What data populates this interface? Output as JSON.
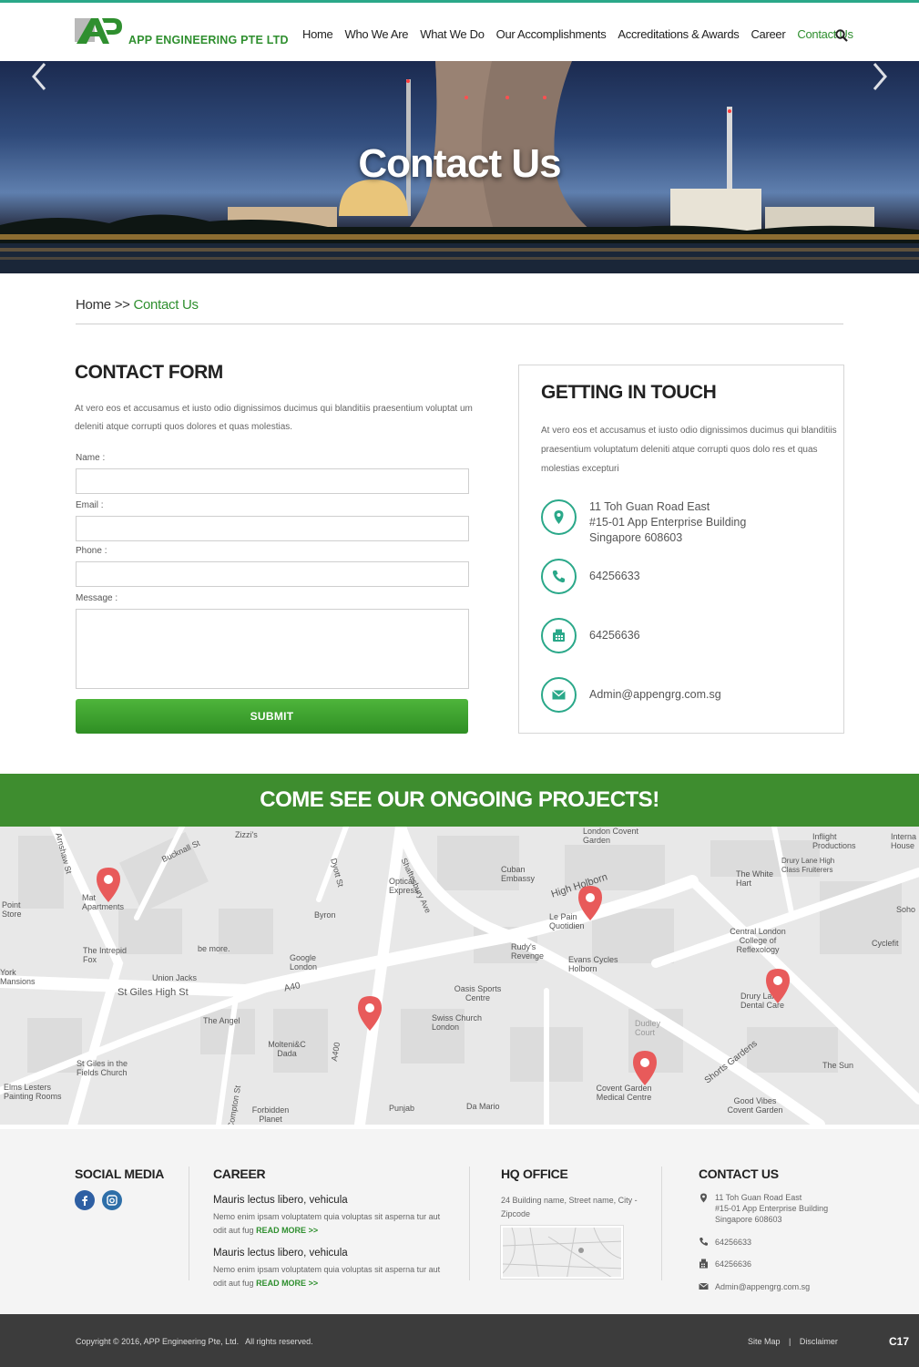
{
  "header": {
    "company": "APP ENGINEERING PTE LTD",
    "nav": [
      "Home",
      "Who We Are",
      "What We Do",
      "Our Accomplishments",
      "Accreditations & Awards",
      "Career",
      "Contact Us"
    ],
    "active_nav": "Contact Us"
  },
  "hero": {
    "title": "Contact Us"
  },
  "breadcrumb": {
    "home": "Home",
    "sep": ">>",
    "current": "Contact Us"
  },
  "contact_form": {
    "title": "CONTACT FORM",
    "description": "At vero eos et accusamus et iusto odio dignissimos ducimus qui blanditiis praesentium voluptat um deleniti atque corrupti quos dolores et quas molestias.",
    "name_label": "Name :",
    "email_label": "Email :",
    "phone_label": "Phone :",
    "message_label": "Message :",
    "name_value": "",
    "email_value": "",
    "phone_value": "",
    "message_value": "",
    "submit_label": "SUBMIT"
  },
  "getting_in_touch": {
    "title": "GETTING IN TOUCH",
    "description": "At vero eos et accusamus et iusto odio dignissimos ducimus qui blanditiis praesentium voluptatum deleniti atque corrupti quos dolo res et quas molestias excepturi",
    "address_line1": "11 Toh Guan Road East",
    "address_line2": "#15-01 App Enterprise Building",
    "address_line3": "Singapore 608603",
    "phone": "64256633",
    "fax": "64256636",
    "email": "Admin@appengrg.com.sg"
  },
  "projects": {
    "title": "COME SEE OUR ONGOING PROJECTS!",
    "map_labels": [
      "Zizzi's",
      "Bucknall St",
      "Optical Express",
      "Shaftesbury Ave",
      "London Covent Garden",
      "Inflight Productions",
      "Interna House",
      "Cuban Embassy",
      "High Holborn",
      "Drury Lane High Class Fruiterers",
      "The White Hart",
      "Point Store",
      "Mat Apartments",
      "Byron",
      "Le Pain Quotidien",
      "Soho",
      "The Intrepid Fox",
      "be more.",
      "Google London",
      "Rudy's Revenge",
      "Evans Cycles Holborn",
      "Central London College of Reflexology",
      "Cyclefit",
      "Union Jacks",
      "St Giles High St",
      "A40",
      "Oasis Sports Centre",
      "Drury Lane Dental Care",
      "The Angel",
      "Swiss Church London",
      "Dudley Court",
      "Molteni&C Dada",
      "A400",
      "St Giles in the Fields Church",
      "Shorts Gardens",
      "The Sun",
      "Elms Lesters Painting Rooms",
      "Covent Garden Medical Centre",
      "Good Vibes Covent Garden",
      "Forbidden Planet",
      "Punjab",
      "Da Mario",
      "York Mansions",
      "Dyott St",
      "Arnshaw St",
      "Compton St"
    ]
  },
  "footer": {
    "social_title": "SOCIAL MEDIA",
    "career_title": "CAREER",
    "career_items": [
      {
        "title": "Mauris lectus libero, vehicula",
        "text": "Nemo enim ipsam voluptatem quia voluptas sit asperna tur aut odit aut fug",
        "more": "READ MORE >>"
      },
      {
        "title": "Mauris lectus libero, vehicula",
        "text": "Nemo enim ipsam voluptatem quia voluptas sit asperna tur aut odit aut fug",
        "more": "READ MORE >>"
      }
    ],
    "hq_title": "HQ OFFICE",
    "hq_address": "24 Building name, Street name, City - Zipcode",
    "contact_title": "CONTACT US",
    "contact_address1": "11 Toh Guan Road East",
    "contact_address2": "#15-01 App Enterprise Building",
    "contact_address3": "Singapore 608603",
    "contact_phone": "64256633",
    "contact_fax": "64256636",
    "contact_email": "Admin@appengrg.com.sg"
  },
  "bottom": {
    "copyright": "Copyright © 2016, APP Engineering Pte, Ltd.   All rights reserved.",
    "sitemap": "Site Map",
    "sep": "|",
    "disclaimer": "Disclaimer",
    "code": "C17"
  },
  "colors": {
    "brand_green": "#2f8f2f",
    "teal": "#2aa889",
    "band_green": "#3e8d2f",
    "pin_red": "#e85a5a"
  }
}
